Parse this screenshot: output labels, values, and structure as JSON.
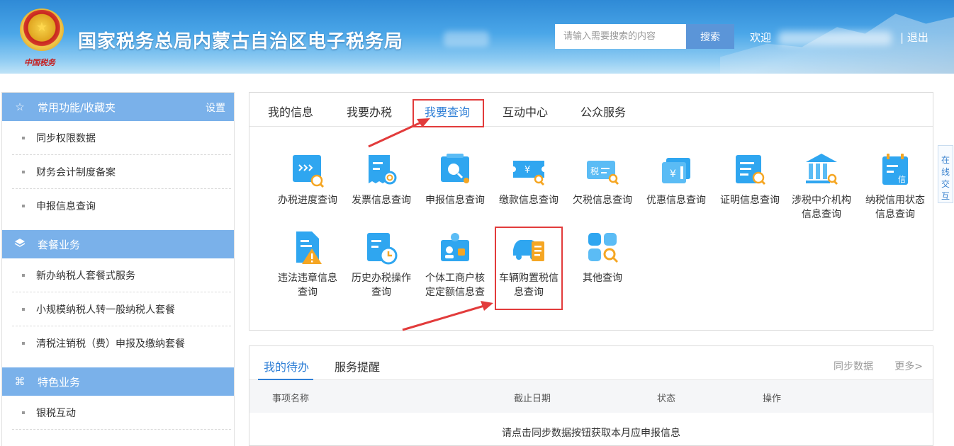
{
  "header": {
    "emblem_text": "中国税务",
    "title": "国家税务总局内蒙古自治区电子税务局",
    "search_placeholder": "请输入需要搜索的内容",
    "search_button": "搜索",
    "welcome": "欢迎",
    "logout": "| 退出"
  },
  "sidebar": {
    "sections": [
      {
        "title": "常用功能/收藏夹",
        "icon": "star-icon",
        "action": "设置",
        "items": [
          "同步权限数据",
          "财务会计制度备案",
          "申报信息查询"
        ]
      },
      {
        "title": "套餐业务",
        "icon": "layers-icon",
        "items": [
          "新办纳税人套餐式服务",
          "小规模纳税人转一般纳税人套餐",
          "清税注销税（费）申报及缴纳套餐"
        ]
      },
      {
        "title": "特色业务",
        "icon": "command-icon",
        "items": [
          "银税互动"
        ]
      }
    ]
  },
  "main_tabs": [
    "我的信息",
    "我要办税",
    "我要查询",
    "互动中心",
    "公众服务"
  ],
  "active_tab": "我要查询",
  "query_items": [
    {
      "label": "办税进度查询",
      "icon": "progress-search-icon"
    },
    {
      "label": "发票信息查询",
      "icon": "invoice-search-icon"
    },
    {
      "label": "申报信息查询",
      "icon": "declaration-search-icon"
    },
    {
      "label": "缴款信息查询",
      "icon": "payment-search-icon"
    },
    {
      "label": "欠税信息查询",
      "icon": "tax-arrears-search-icon"
    },
    {
      "label": "优惠信息查询",
      "icon": "discount-search-icon"
    },
    {
      "label": "证明信息查询",
      "icon": "certificate-search-icon"
    },
    {
      "label": "涉税中介机构信息查询",
      "icon": "agency-search-icon"
    },
    {
      "label": "纳税信用状态信息查询",
      "icon": "credit-status-icon"
    },
    {
      "label": "违法违章信息查询",
      "icon": "violation-warning-icon"
    },
    {
      "label": "历史办税操作查询",
      "icon": "history-clock-icon"
    },
    {
      "label": "个体工商户核定定额信息查",
      "icon": "individual-business-icon"
    },
    {
      "label": "车辆购置税信息查询",
      "icon": "vehicle-tax-icon"
    },
    {
      "label": "其他查询",
      "icon": "apps-search-icon"
    }
  ],
  "online_tab": "在线交互",
  "bottom": {
    "tabs": [
      "我的待办",
      "服务提醒"
    ],
    "sync": "同步数据",
    "more": "更多>",
    "columns": [
      "事项名称",
      "截止日期",
      "状态",
      "操作"
    ],
    "empty_message": "请点击同步数据按钮获取本月应申报信息"
  },
  "colors": {
    "accent": "#2f7fd6",
    "sidebar_header": "#7ab1ea",
    "highlight": "#e23b3b",
    "icon_blue": "#2fa6f0",
    "icon_orange": "#f5a623"
  }
}
